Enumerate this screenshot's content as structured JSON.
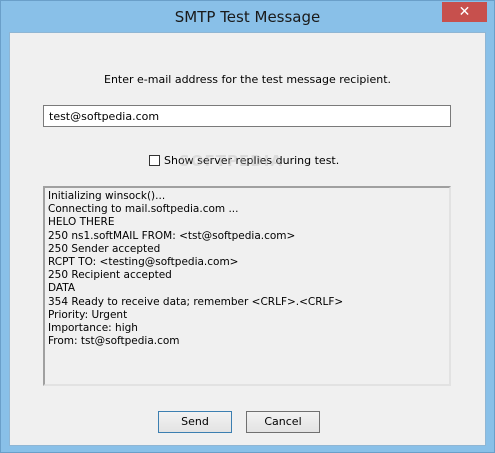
{
  "window": {
    "title": "SMTP Test Message",
    "close_label": "✕"
  },
  "prompt": "Enter e-mail address for the test message recipient.",
  "email": {
    "value": "test@softpedia.com"
  },
  "checkbox": {
    "label": "Show server replies during test.",
    "checked": false
  },
  "log": {
    "lines": [
      "Initializing winsock()...",
      "Connecting to mail.softpedia.com ...",
      "HELO THERE",
      "250 ns1.softMAIL FROM: <tst@softpedia.com>",
      "250 Sender accepted",
      "RCPT TO: <testing@softpedia.com>",
      "250 Recipient accepted",
      "DATA",
      "354 Ready to receive data; remember <CRLF>.<CRLF>",
      "Priority: Urgent",
      "Importance: high",
      "From: tst@softpedia.com"
    ]
  },
  "buttons": {
    "send": "Send",
    "cancel": "Cancel"
  },
  "watermark": "SOFTPEDIA"
}
